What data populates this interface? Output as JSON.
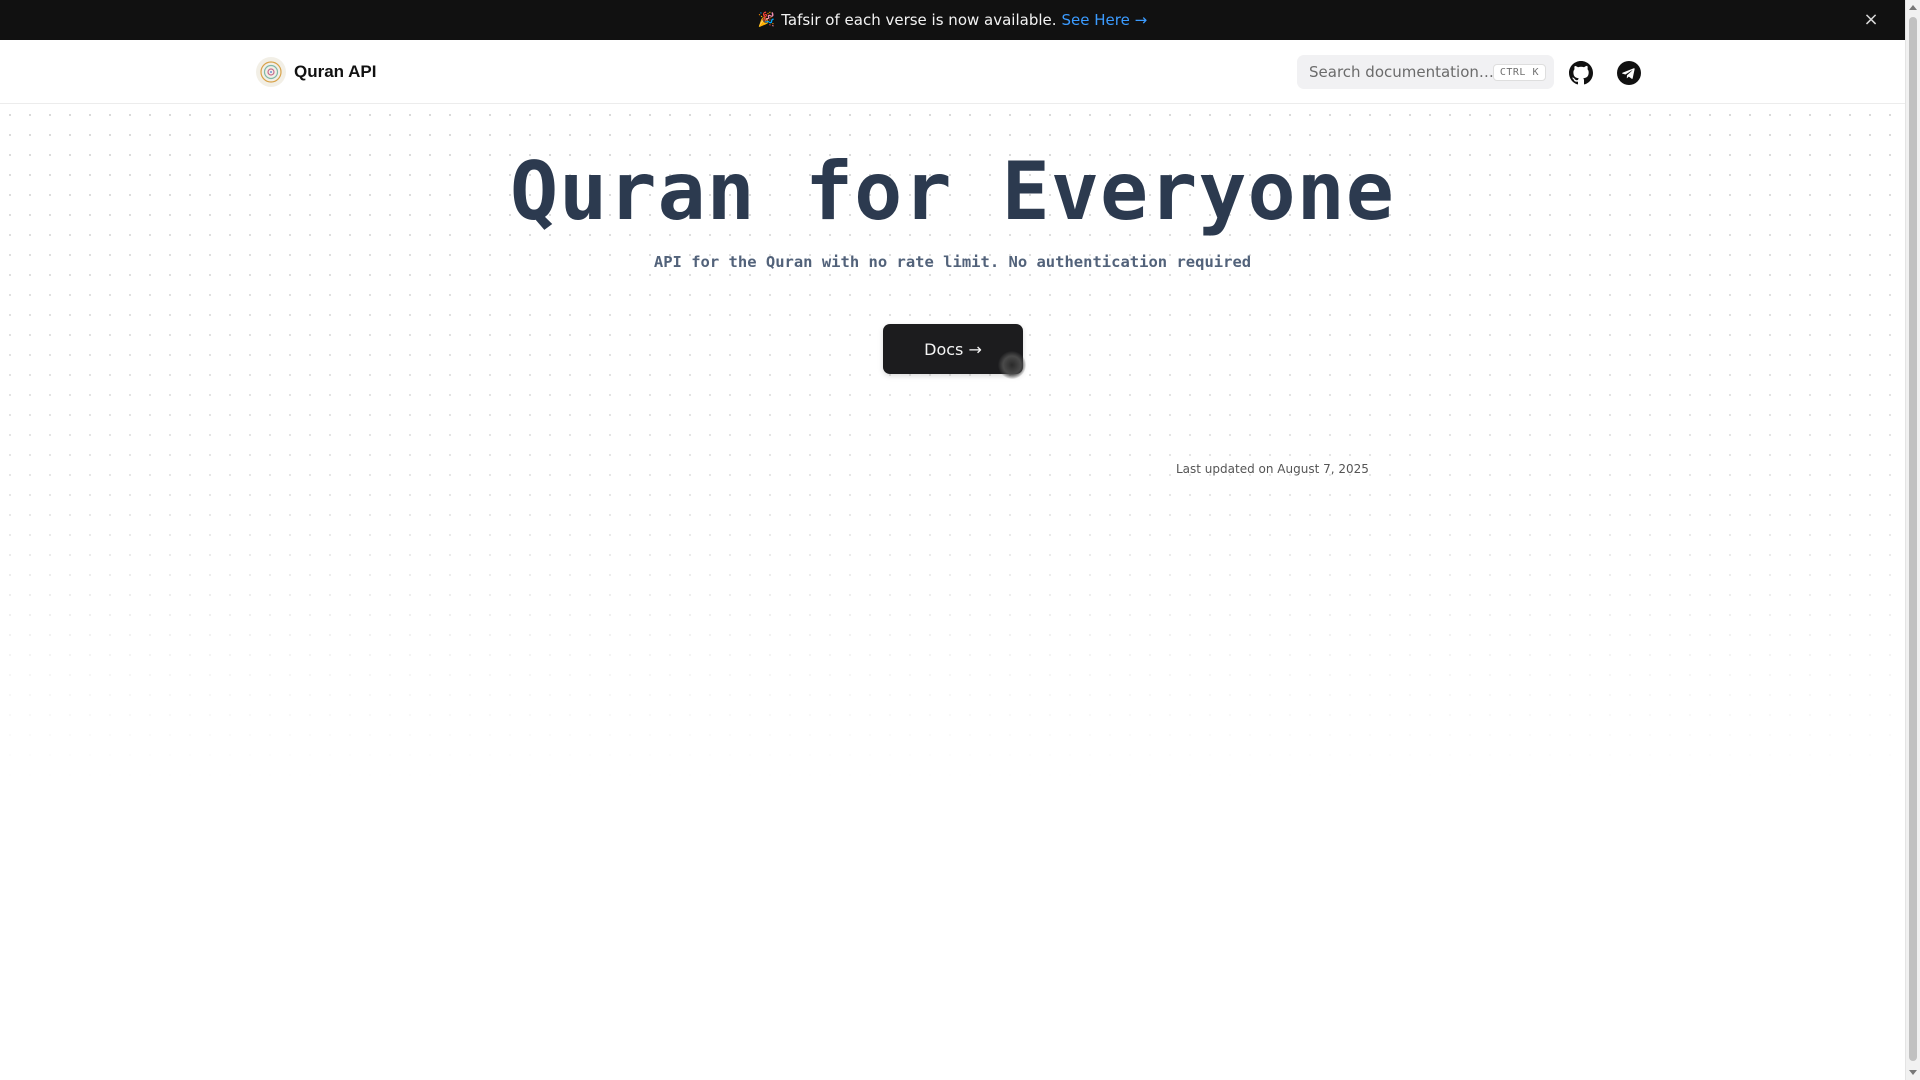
{
  "banner": {
    "emoji": "🎉",
    "text": "Tafsir of each verse is now available.",
    "link_label": "See Here →",
    "close_glyph": "×"
  },
  "navbar": {
    "brand_name": "Quran API",
    "logo_icon": "quran-logo-icon",
    "search_placeholder": "Search documentation…",
    "search_shortcut": "CTRL K",
    "github_icon": "github-icon",
    "telegram_icon": "telegram-icon"
  },
  "hero": {
    "title": "Quran for Everyone",
    "subtitle": "API for the Quran with no rate limit. No authentication required",
    "docs_label": "Docs →",
    "last_updated": "Last updated on August 7, 2025"
  },
  "colors": {
    "banner_bg": "#111111",
    "link": "#3b9bff",
    "title": "#2c3a4f",
    "subtitle": "#52627a",
    "button_bg": "#1c1c1e"
  }
}
